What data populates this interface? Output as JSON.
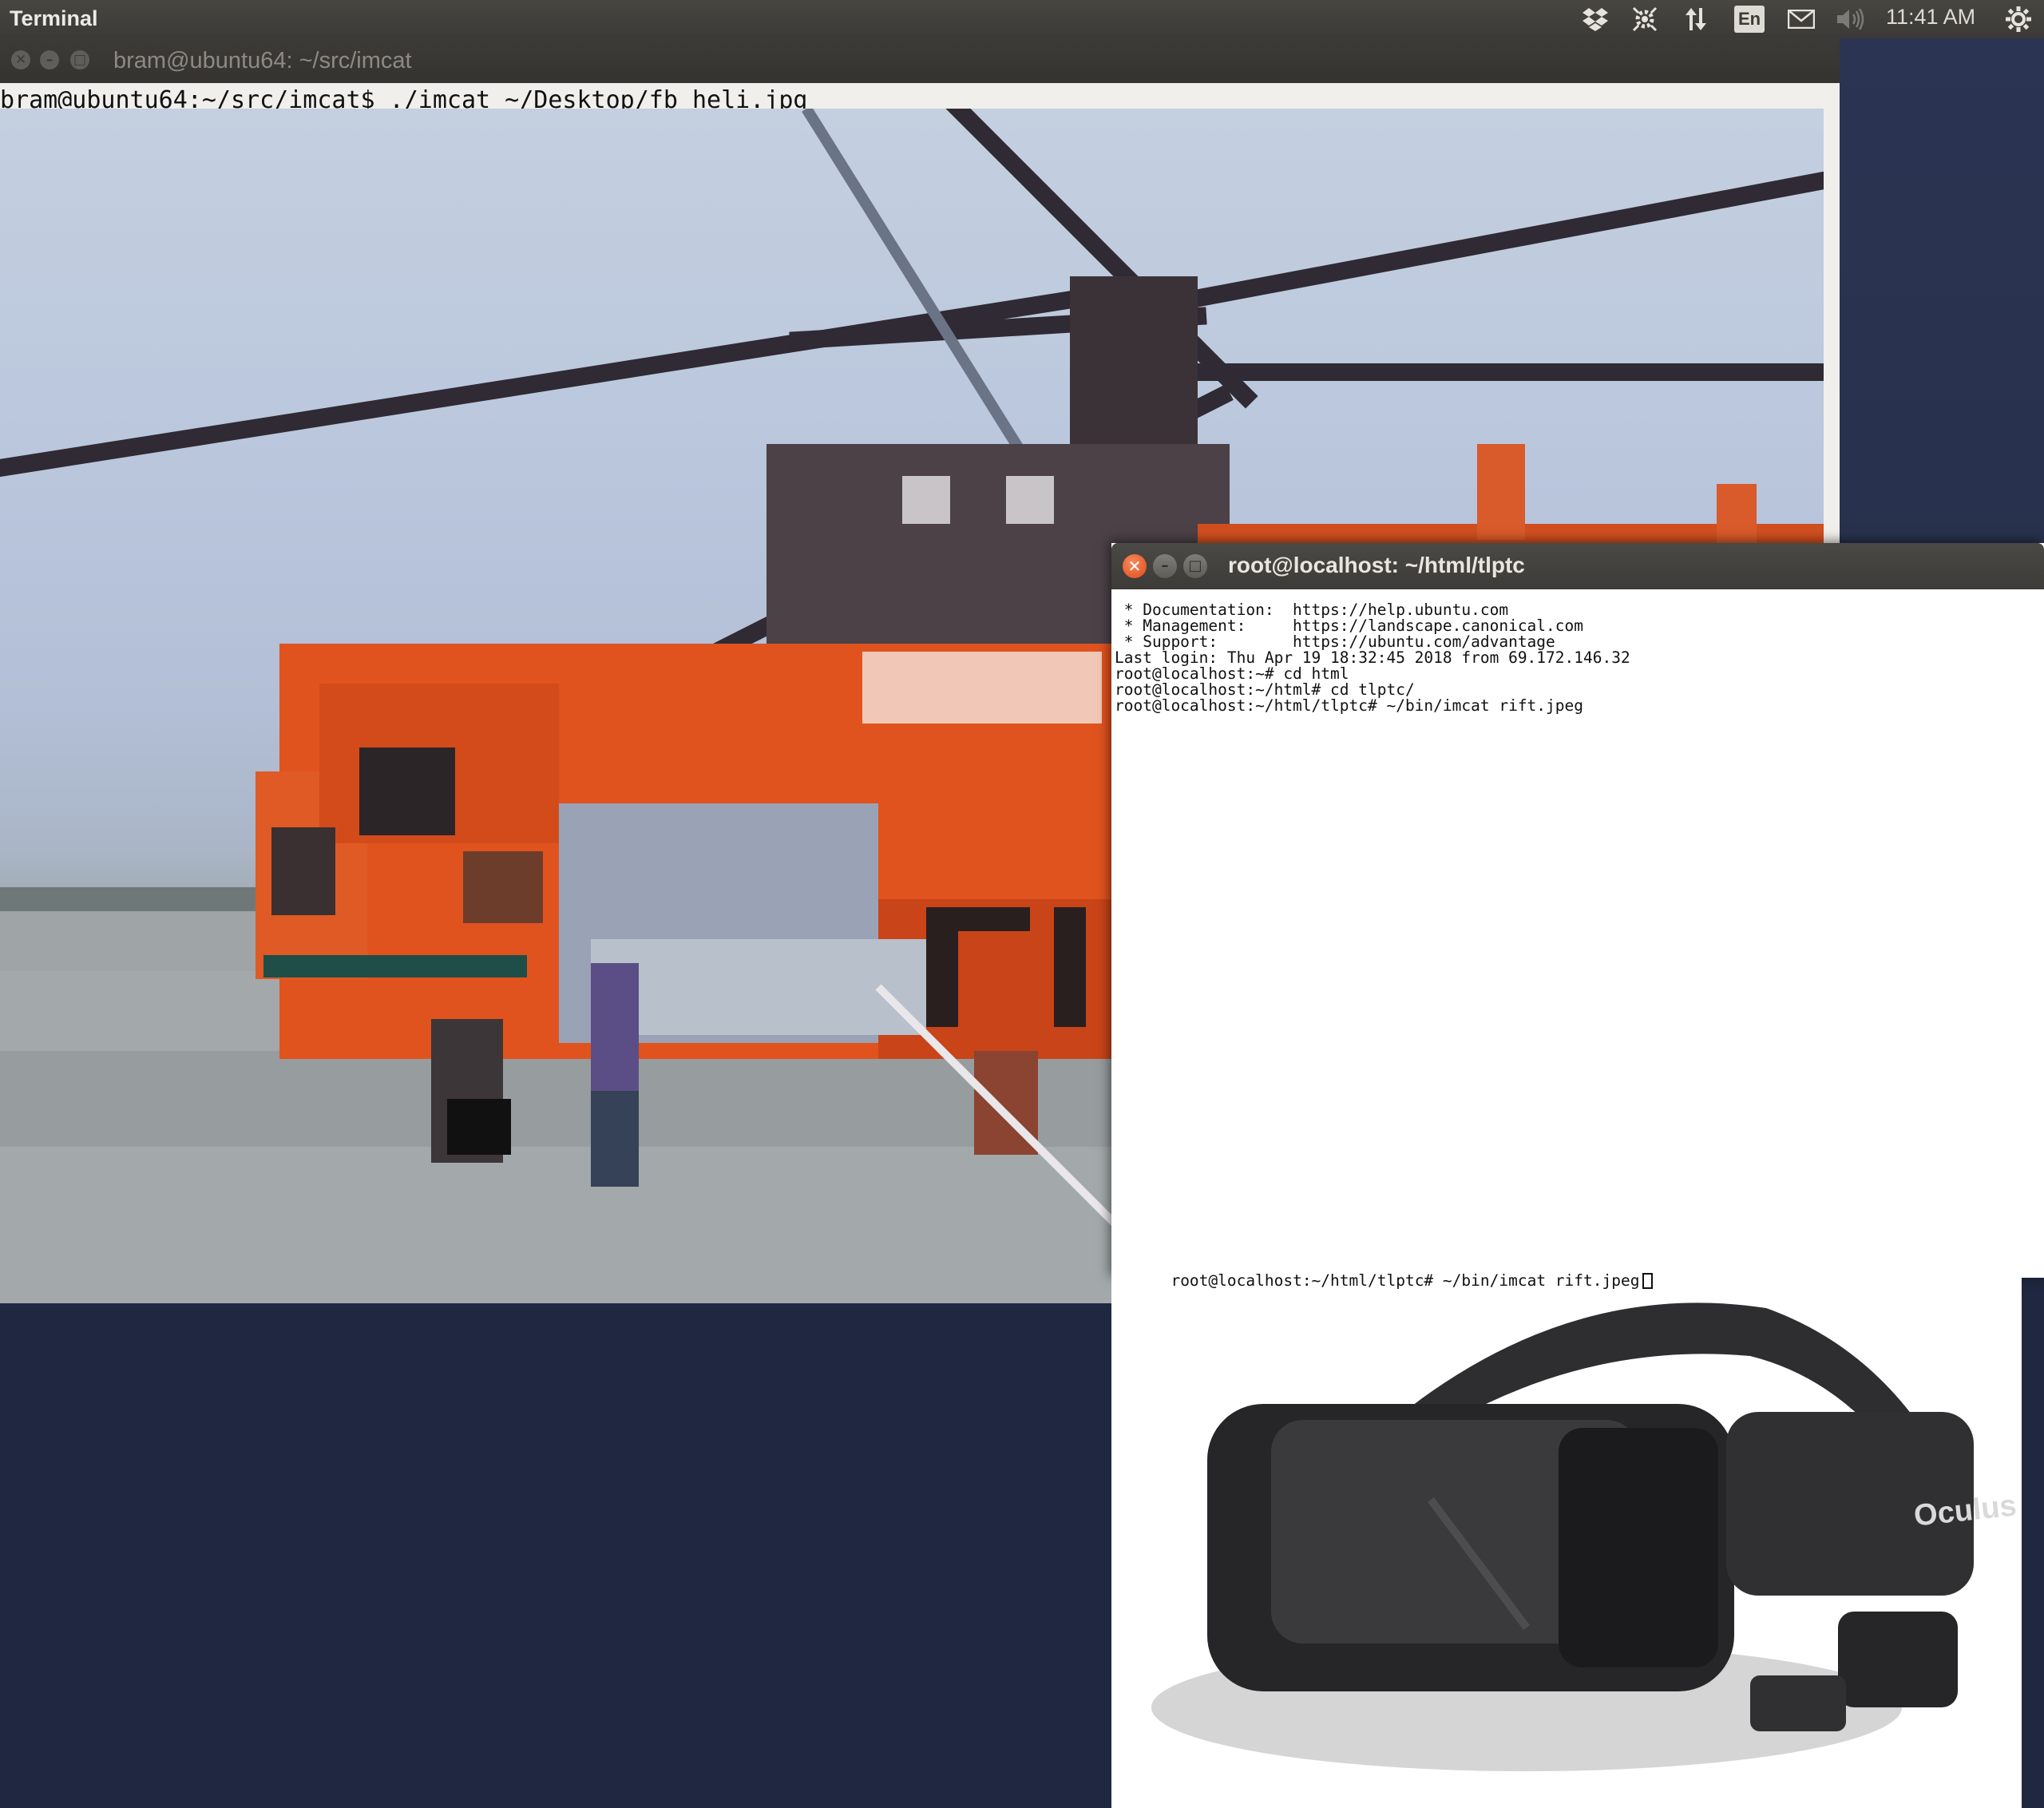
{
  "panel": {
    "app_title": "Terminal",
    "language": "En",
    "clock": "11:41 AM",
    "icons": [
      "dropbox-icon",
      "network-settings-icon",
      "transfer-arrows-icon",
      "mail-icon",
      "volume-icon",
      "system-gear-icon"
    ]
  },
  "main_window": {
    "title": "bram@ubuntu64: ~/src/imcat",
    "command_line": "bram@ubuntu64:~/src/imcat$ ./imcat ~/Desktop/fb_heli.jpg",
    "buttons": {
      "close": "✕",
      "minimize": "–",
      "maximize": "□"
    }
  },
  "ssh_window": {
    "title": "root@localhost: ~/html/tlptc",
    "buttons": {
      "close": "✕",
      "minimize": "–",
      "maximize": "□"
    },
    "lines": [
      " * Documentation:  https://help.ubuntu.com",
      " * Management:     https://landscape.canonical.com",
      " * Support:        https://ubuntu.com/advantage",
      "Last login: Thu Apr 19 18:32:45 2018 from 69.172.146.32",
      "root@localhost:~# cd html",
      "root@localhost:~/html# cd tlptc/",
      "root@localhost:~/html/tlptc# ~/bin/imcat rift.jpeg"
    ],
    "prompt_line": "root@localhost:~/html/tlptc# ~/bin/imcat rift.jpeg",
    "image_logo": "Oculus"
  },
  "colors": {
    "helicopter_orange": "#e2531f",
    "panel_bg": "#3b3a36",
    "close_button": "#df4a16"
  }
}
